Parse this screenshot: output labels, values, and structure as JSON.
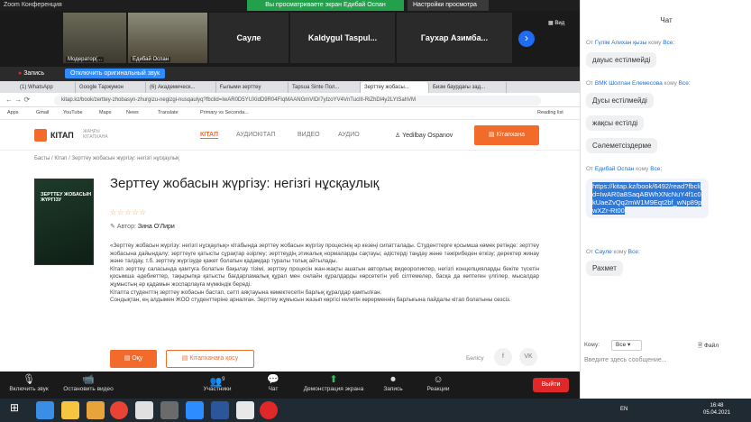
{
  "zoom": {
    "title": "Zoom Конференция",
    "viewing_banner": "Вы просматриваете экран Едибай Оспан",
    "view_options": "Настройки просмотра",
    "view_label": "Вид",
    "participants": [
      {
        "label": "Модератор(...",
        "type": "video"
      },
      {
        "label": "Едибай Оспан",
        "type": "video"
      },
      {
        "label": "Сауле",
        "type": "name"
      },
      {
        "label": "Kaldygul Taspul...",
        "type": "name"
      },
      {
        "label": "Гаухар Азимба...",
        "type": "name"
      }
    ],
    "record_label": "Запись",
    "original_sound": "Отключить оригинальный звук",
    "controls": [
      {
        "icon": "🎙",
        "label": "Включить звук"
      },
      {
        "icon": "📹",
        "label": "Остановить видео"
      },
      {
        "icon": "👥",
        "label": "Участники"
      },
      {
        "icon": "💬",
        "label": "Чат"
      },
      {
        "icon": "⬆",
        "label": "Демонстрация экрана"
      },
      {
        "icon": "⏺",
        "label": "Запись"
      },
      {
        "icon": "☺",
        "label": "Реакции"
      }
    ],
    "participants_count": "9",
    "leave": "Выйти"
  },
  "browser": {
    "tabs": [
      "(1) WhatsApp",
      "Google Таржумон",
      "(6) Академическ...",
      "Ғылыми зерттеу",
      "Tapsua Sinte Пол...",
      "Зерттеу жобасы...",
      "Бизм баурдағы зад..."
    ],
    "url": "kitap.kz/book/zerttey-zhobasyn-zhurgizu-negizgi-nusqaulyq?fbclid=IwAR0D5YUXIdD9R04FIqMAANGmVIDr7yIzoYV4VnTuclII-RiZhDl4y2LYtSahVM",
    "bookmarks": [
      "Apps",
      "Gmail",
      "YouTube",
      "Maps",
      "News",
      "Translate",
      "Primary vs Seconda..."
    ],
    "reading_list": "Reading list"
  },
  "site": {
    "logo": "КІТАП",
    "logo_sub1": "ЖАҢҒЫ",
    "logo_sub2": "КІТАПХАНА",
    "nav": [
      "КІТАП",
      "АУДИОКІТАП",
      "ВИДЕО",
      "АУДИО"
    ],
    "user": "Yedilbay Ospanov",
    "library_btn": "Кітапхана",
    "breadcrumb": "Басты / Кітап / Зерттеу жобасын жүргізу: негізгі нұсқаулық",
    "cover_title": "ЗЕРТТЕУ ЖОБАСЫН ЖҮРГІЗУ",
    "book_title": "Зерттеу жобасын жүргізу: негізгі нұсқаулық",
    "stars": "☆☆☆☆☆",
    "author_label": "Автор:",
    "author": "Зина О'Лири",
    "desc": [
      "«Зерттеу жобасын жүргізу: негізгі нұсқаулық» кітабында зерттеу жобасын жүргізу процесінің әр кезеңі сипатталады. Студенттерге қосымша көмек ретінде: зерттеу жобасына дайындалу; зерттеуге қатысты сұрақтар әзірлеу; зерттеудің этикалық нормаларды сақтауы; әдістерді таңдау және тәжірибеден өткізу; деректер жинау және талдау, т.б. зерттеу жүргізуде қажет болатын қадамдар туралы толық айтылады.",
      "Кітап зерттеу саласында қамтуға болатын бақылау тізімі, зерттеу процесін жан-жақты ашатын авторлық видеороликтер, негізгі концепцияларды бекіте түсетін қосымша әдебиеттер, тақырыпқа қатысты бағдарламалық құрал мен онлайн құралдарды көрсететін уеб сілтемелер, басқа да көптеген үлгілер, мысалдар жұмыстың әр қадамын жоспарлауға мүмкіндік береді.",
      "Кітапта студенттің зерттеу жобасын бастап, сәтті аяқтауына көмектесетін барлық құралдар қамтылған.",
      "Сондықтан, ең алдымен ЖОО студенттеріне арналған. Зерттеу жұмысын жазып көргісі келетін көрерменнің барлығына пайдалы кітап болатыны сөзсіз."
    ],
    "read_btn": "Оқу",
    "add_btn": "Кітапханаға қосу",
    "share": "Бөлісу",
    "social": [
      "f",
      "VK"
    ]
  },
  "chat": {
    "title": "Чат",
    "messages": [
      {
        "from_pre": "От",
        "from": "Гүлім Алихан қызы",
        "to_pre": "кому",
        "to": "Все:",
        "text": "дауыс естілмейді"
      },
      {
        "from_pre": "От",
        "from": "ВМК Шолпан Елемесова",
        "to_pre": "кому",
        "to": "Все:",
        "text": "Дусы естілмейді"
      },
      {
        "text": "жақсы естілді"
      },
      {
        "text": "Сәлеметсіздерме"
      },
      {
        "from_pre": "От",
        "from": "Едибай Оспан",
        "to_pre": "кому",
        "to": "Все:",
        "text": "https://kitap.kz/book/6492/read?fbclid=IwAR0a8SaqABWhXNcNuY4f1c0kUaeZvQq2mW1M9Eqt2bf_wNp89pwXZr-Rt00"
      },
      {
        "from_pre": "От",
        "from": "Сауле",
        "to_pre": "кому",
        "to": "Все:",
        "text": "Рахмет"
      }
    ],
    "to_label": "Кому:",
    "to_value": "Все",
    "file_label": "Файл",
    "input_placeholder": "Введите здесь сообщение..."
  },
  "taskbar": {
    "lang": "EN",
    "time": "16:48",
    "date": "05.04.2021"
  }
}
